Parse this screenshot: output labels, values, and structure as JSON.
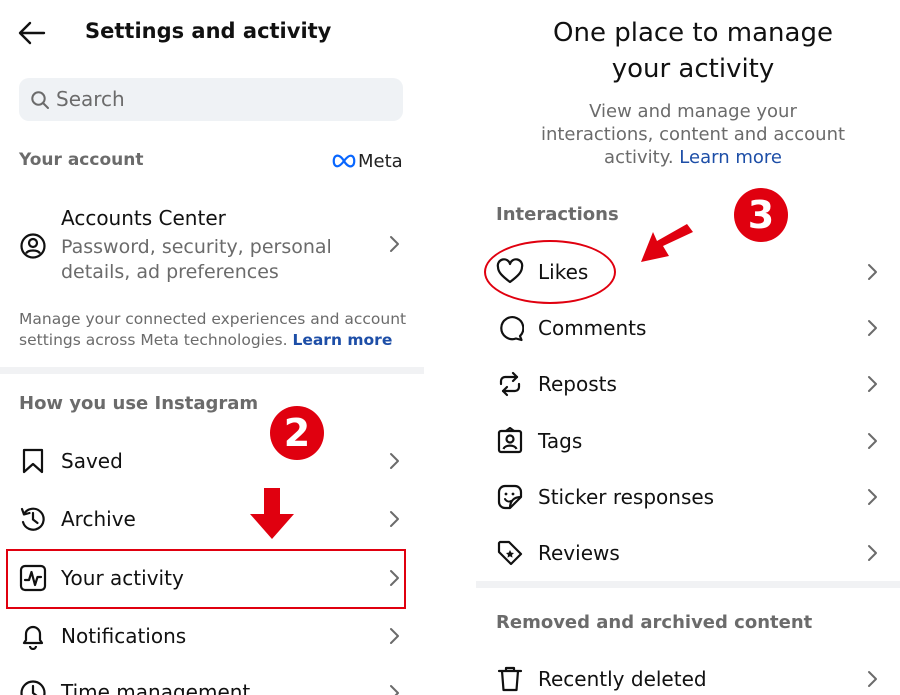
{
  "left": {
    "header_title": "Settings and activity",
    "search_placeholder": "Search",
    "your_account_label": "Your account",
    "meta_logo_text": "Meta",
    "accounts_center": {
      "title": "Accounts Center",
      "subtitle_line1": "Password, security, personal",
      "subtitle_line2": "details, ad preferences"
    },
    "manage_text_line1": "Manage your connected experiences and account",
    "manage_text_line2": "settings across Meta technologies.",
    "learn_more": "Learn more",
    "section_label": "How you use Instagram",
    "items": [
      {
        "label": "Saved",
        "icon": "bookmark-icon"
      },
      {
        "label": "Archive",
        "icon": "archive-clock-icon"
      },
      {
        "label": "Your activity",
        "icon": "activity-icon"
      },
      {
        "label": "Notifications",
        "icon": "bell-icon"
      },
      {
        "label": "Time management",
        "icon": "clock-icon"
      }
    ],
    "step_badge": "2"
  },
  "right": {
    "title_line1": "One place to manage",
    "title_line2": "your activity",
    "desc_line1": "View and manage your",
    "desc_line2": "interactions, content and account",
    "desc_line3": "activity.",
    "learn_more": "Learn more",
    "section1_label": "Interactions",
    "items": [
      {
        "label": "Likes",
        "icon": "heart-icon"
      },
      {
        "label": "Comments",
        "icon": "comment-icon"
      },
      {
        "label": "Reposts",
        "icon": "repost-icon"
      },
      {
        "label": "Tags",
        "icon": "tag-person-icon"
      },
      {
        "label": "Sticker responses",
        "icon": "sticker-icon"
      },
      {
        "label": "Reviews",
        "icon": "review-tag-icon"
      }
    ],
    "section2_label": "Removed and archived content",
    "recently_deleted": "Recently deleted",
    "step_badge": "3"
  },
  "colors": {
    "annotation_red": "#e0000f",
    "link_blue": "#1d4ea7",
    "muted_text": "#6b6b6b",
    "search_bg": "#eff2f5"
  }
}
